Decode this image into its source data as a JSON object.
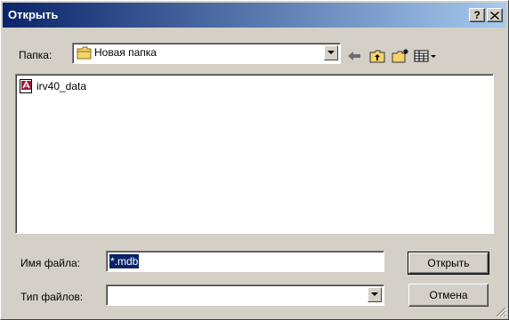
{
  "window": {
    "title": "Открыть",
    "help_label": "?",
    "close_label": "✕"
  },
  "toolbar": {
    "folder_label": "Папка:",
    "folder_value": "Новая папка",
    "icons": [
      "back-arrow-icon",
      "up-folder-icon",
      "new-folder-icon",
      "view-menu-icon"
    ]
  },
  "file_list": {
    "items": [
      {
        "name": "irv40_data",
        "icon": "access-database-icon"
      }
    ]
  },
  "form": {
    "filename_label": "Имя файла:",
    "filename_value": "*.mdb",
    "filetype_label": "Тип файлов:",
    "filetype_value": ""
  },
  "buttons": {
    "open_label": "Открыть",
    "cancel_label": "Отмена"
  },
  "colors": {
    "title_start": "#0a246a",
    "title_end": "#a6caf0",
    "face": "#d4d0c8",
    "selection": "#0a246a"
  }
}
